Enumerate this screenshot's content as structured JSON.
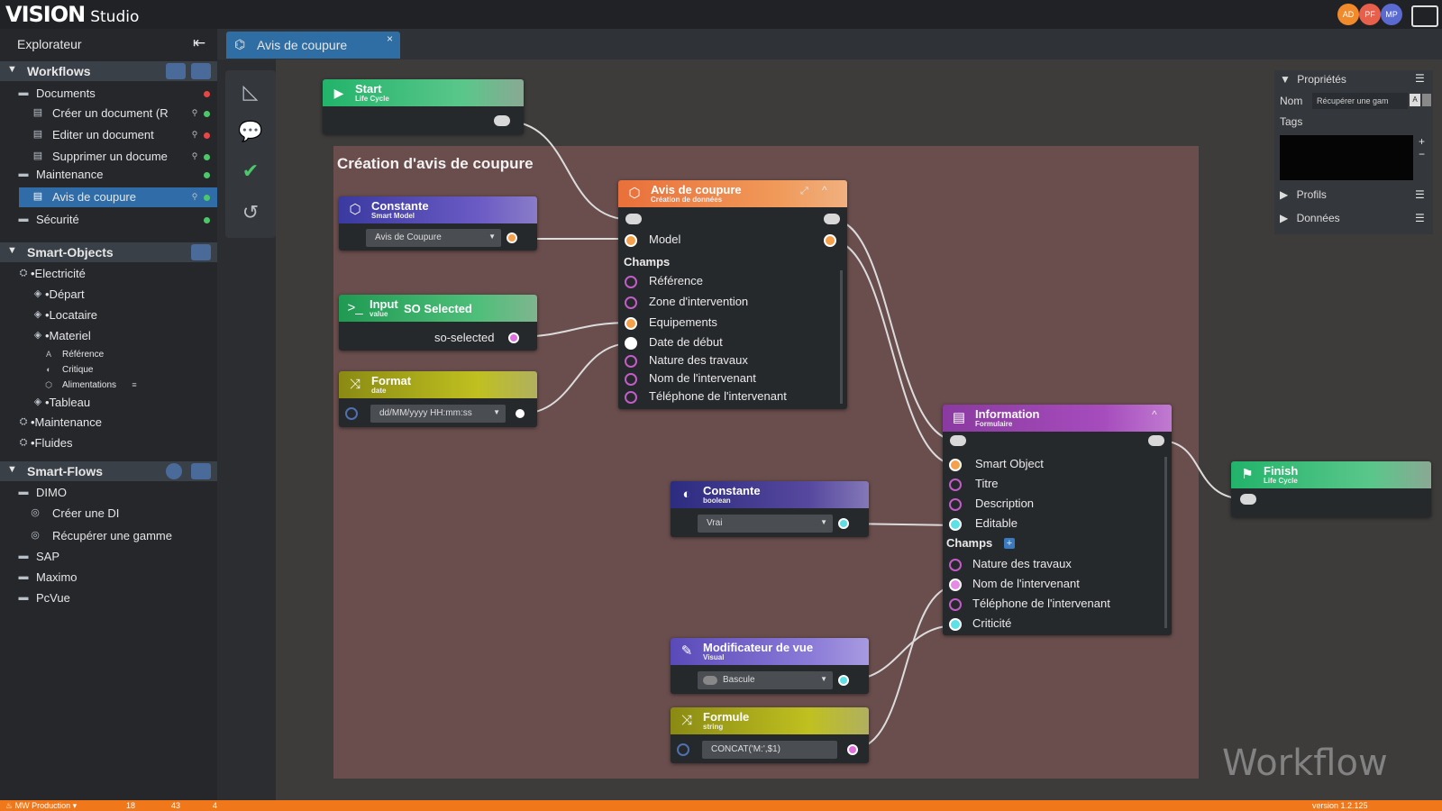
{
  "app": {
    "logo": "VISION",
    "logo_suffix": "Studio"
  },
  "avatars": [
    {
      "initials": "AD",
      "color": "#f08a2a"
    },
    {
      "initials": "PF",
      "color": "#e8604c"
    },
    {
      "initials": "MP",
      "color": "#5b6ad0"
    }
  ],
  "explorer": {
    "title": "Explorateur"
  },
  "workflows": {
    "label": "Workflows",
    "items": [
      {
        "label": "Documents",
        "dot": "#e84545"
      },
      {
        "label": "Créer un document (R",
        "dot": "#4cc86a"
      },
      {
        "label": "Editer un document",
        "dot": "#e84545"
      },
      {
        "label": "Supprimer un docume",
        "dot": "#4cc86a"
      },
      {
        "label": "Maintenance",
        "dot": "#4cc86a"
      },
      {
        "label": "Avis de coupure",
        "dot": "#4cc86a"
      },
      {
        "label": "Sécurité",
        "dot": "#4cc86a"
      }
    ]
  },
  "smart_objects": {
    "label": "Smart-Objects",
    "items": [
      {
        "label": "•Electricité"
      },
      {
        "label": "•Départ"
      },
      {
        "label": "•Locataire"
      },
      {
        "label": "•Materiel"
      },
      {
        "label": "Référence"
      },
      {
        "label": "Critique"
      },
      {
        "label": "Alimentations"
      },
      {
        "label": "•Tableau"
      },
      {
        "label": "•Maintenance"
      },
      {
        "label": "•Fluides"
      }
    ]
  },
  "smart_flows": {
    "label": "Smart-Flows",
    "items": [
      {
        "label": "DIMO"
      },
      {
        "label": "Créer une DI"
      },
      {
        "label": "Récupérer une gamme"
      },
      {
        "label": "SAP"
      },
      {
        "label": "Maximo"
      },
      {
        "label": "PcVue"
      }
    ]
  },
  "tab": {
    "label": "Avis de coupure",
    "close": "×"
  },
  "canvas": {
    "group_title": "Création d'avis de coupure",
    "watermark": "Workflow"
  },
  "nodes": {
    "start": {
      "title": "Start",
      "subtitle": "Life Cycle"
    },
    "constante1": {
      "title": "Constante",
      "subtitle": "Smart Model",
      "value": "Avis de Coupure"
    },
    "input": {
      "title": "Input",
      "subtitle": "value",
      "extra": "SO Selected",
      "output": "so-selected"
    },
    "format": {
      "title": "Format",
      "subtitle": "date",
      "value": "dd/MM/yyyy HH:mm:ss"
    },
    "avis": {
      "title": "Avis de coupure",
      "subtitle": "Création de données",
      "model": "Model",
      "champs": "Champs",
      "fields": [
        "Référence",
        "Zone d'intervention",
        "Equipements",
        "Date de début",
        "Nature des travaux",
        "Nom de l'intervenant",
        "Téléphone de l'intervenant"
      ]
    },
    "constante2": {
      "title": "Constante",
      "subtitle": "boolean",
      "value": "Vrai"
    },
    "information": {
      "title": "Information",
      "subtitle": "Formulaire",
      "top_fields": [
        "Smart Object",
        "Titre",
        "Description",
        "Editable"
      ],
      "champs": "Champs",
      "fields": [
        "Nature des travaux",
        "Nom de l'intervenant",
        "Téléphone de l'intervenant",
        "Criticité"
      ]
    },
    "modificateur": {
      "title": "Modificateur de vue",
      "subtitle": "Visual",
      "value": "Bascule"
    },
    "formule": {
      "title": "Formule",
      "subtitle": "string",
      "value": "CONCAT('M:',$1)"
    },
    "finish": {
      "title": "Finish",
      "subtitle": "Life Cycle"
    }
  },
  "properties": {
    "title": "Propriétés",
    "nom_label": "Nom",
    "nom_value": "Récupérer une gam",
    "tags_label": "Tags",
    "profils": "Profils",
    "donnees": "Données"
  },
  "status": {
    "env": "MW Production",
    "count1": "18",
    "count2": "43",
    "count3": "4",
    "version": "version 1.2.125"
  }
}
